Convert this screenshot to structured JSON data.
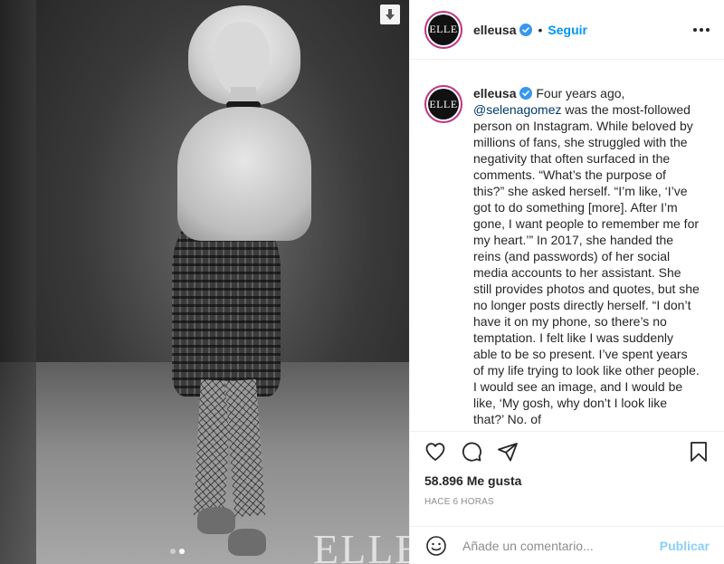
{
  "photo": {
    "watermark": "ELLE",
    "carousel_dots": 2,
    "carousel_active_index": 1
  },
  "header": {
    "avatar_text": "ELLE",
    "username": "elleusa",
    "separator": "•",
    "follow_label": "Seguir"
  },
  "caption": {
    "avatar_text": "ELLE",
    "username": "elleusa",
    "text_before_mention": "Four years ago,",
    "mention": "@selenagomez",
    "text_after_mention": "was the most-followed person on Instagram. While beloved by millions of fans, she struggled with the negativity that often surfaced in the comments. “What’s the purpose of this?” she asked herself. “I’m like, ‘I’ve got to do something [more]. After I’m gone, I want people to remember me for my heart.’” In 2017, she handed the reins (and passwords) of her social media accounts to her assistant. She still provides photos and quotes, but she no longer posts directly herself. “I don’t have it on my phone, so there’s no temptation. I felt like I was suddenly able to be so present. I’ve spent years of my life trying to look like other people. I would see an image, and I would be like, ‘My gosh, why don’t I look like that?’ No. of"
  },
  "actions": {
    "icons": [
      "heart-icon",
      "comment-icon",
      "share-icon",
      "bookmark-icon"
    ]
  },
  "likes": "58.896 Me gusta",
  "timestamp": "HACE 6 HORAS",
  "comment": {
    "placeholder": "Añade un comentario...",
    "publish_label": "Publicar"
  },
  "colors": {
    "accent": "#0095f6",
    "text": "#262626",
    "muted": "#8e8e8e",
    "mention": "#00376b"
  }
}
